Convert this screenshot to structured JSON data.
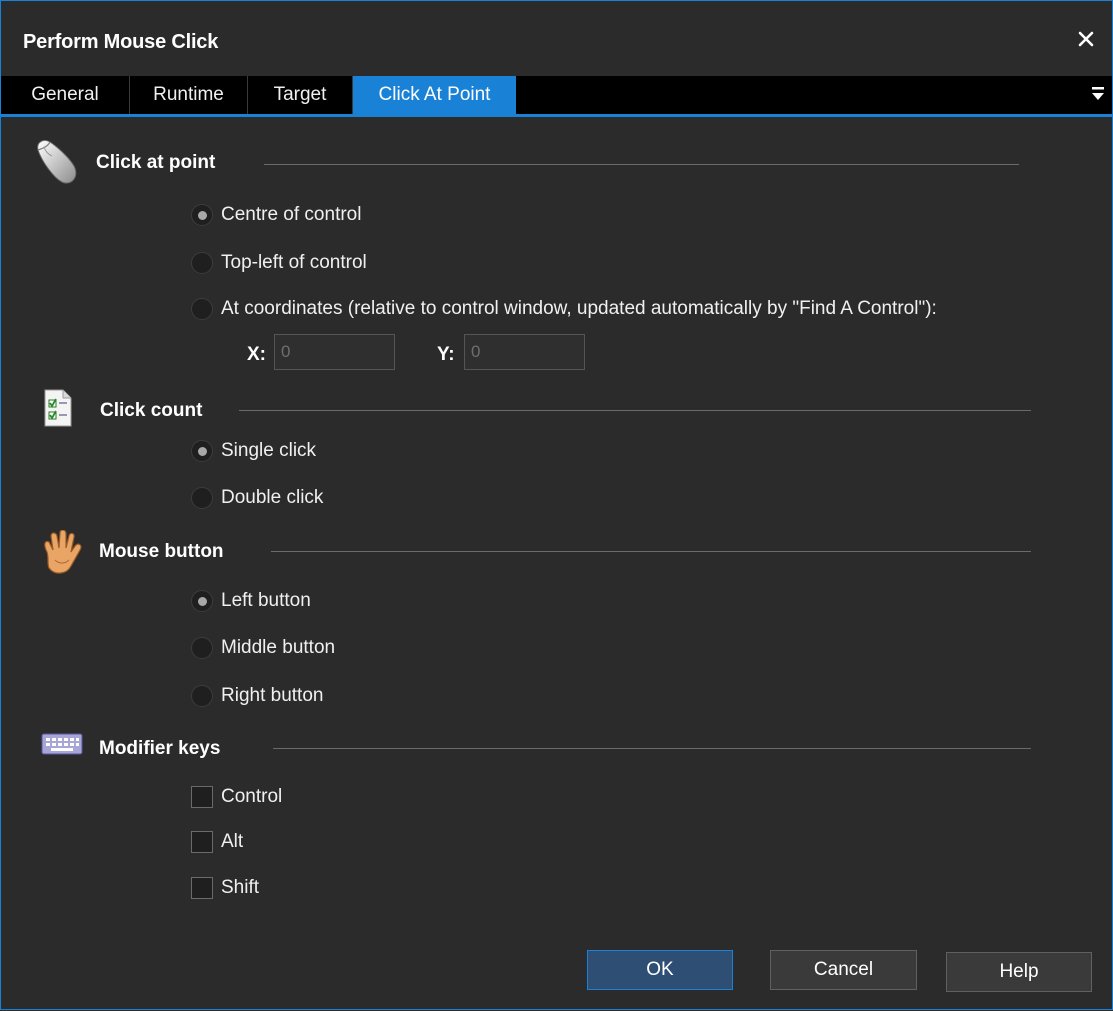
{
  "window": {
    "title": "Perform Mouse Click",
    "close_glyph": "✕"
  },
  "tabs": [
    {
      "label": "General"
    },
    {
      "label": "Runtime"
    },
    {
      "label": "Target"
    },
    {
      "label": "Click At Point"
    }
  ],
  "sections": {
    "click_at_point": {
      "title": "Click at point",
      "icon": "mouse-icon",
      "options": [
        {
          "label": "Centre of control",
          "selected": true
        },
        {
          "label": "Top-left of control",
          "selected": false
        },
        {
          "label": "At coordinates (relative to control window, updated automatically by \"Find A Control\"):",
          "selected": false
        }
      ],
      "x_label": "X:",
      "x_value": "0",
      "y_label": "Y:",
      "y_value": "0"
    },
    "click_count": {
      "title": "Click count",
      "icon": "checklist-icon",
      "options": [
        {
          "label": "Single click",
          "selected": true
        },
        {
          "label": "Double click",
          "selected": false
        }
      ]
    },
    "mouse_button": {
      "title": "Mouse button",
      "icon": "hand-icon",
      "options": [
        {
          "label": "Left button",
          "selected": true
        },
        {
          "label": "Middle button",
          "selected": false
        },
        {
          "label": "Right button",
          "selected": false
        }
      ]
    },
    "modifier_keys": {
      "title": "Modifier keys",
      "icon": "keyboard-icon",
      "options": [
        {
          "label": "Control",
          "checked": false
        },
        {
          "label": "Alt",
          "checked": false
        },
        {
          "label": "Shift",
          "checked": false
        }
      ]
    }
  },
  "buttons": {
    "ok": "OK",
    "cancel": "Cancel",
    "help": "Help"
  },
  "colors": {
    "accent": "#1a82d6",
    "background": "#2b2b2b",
    "tabbar": "#000000"
  }
}
